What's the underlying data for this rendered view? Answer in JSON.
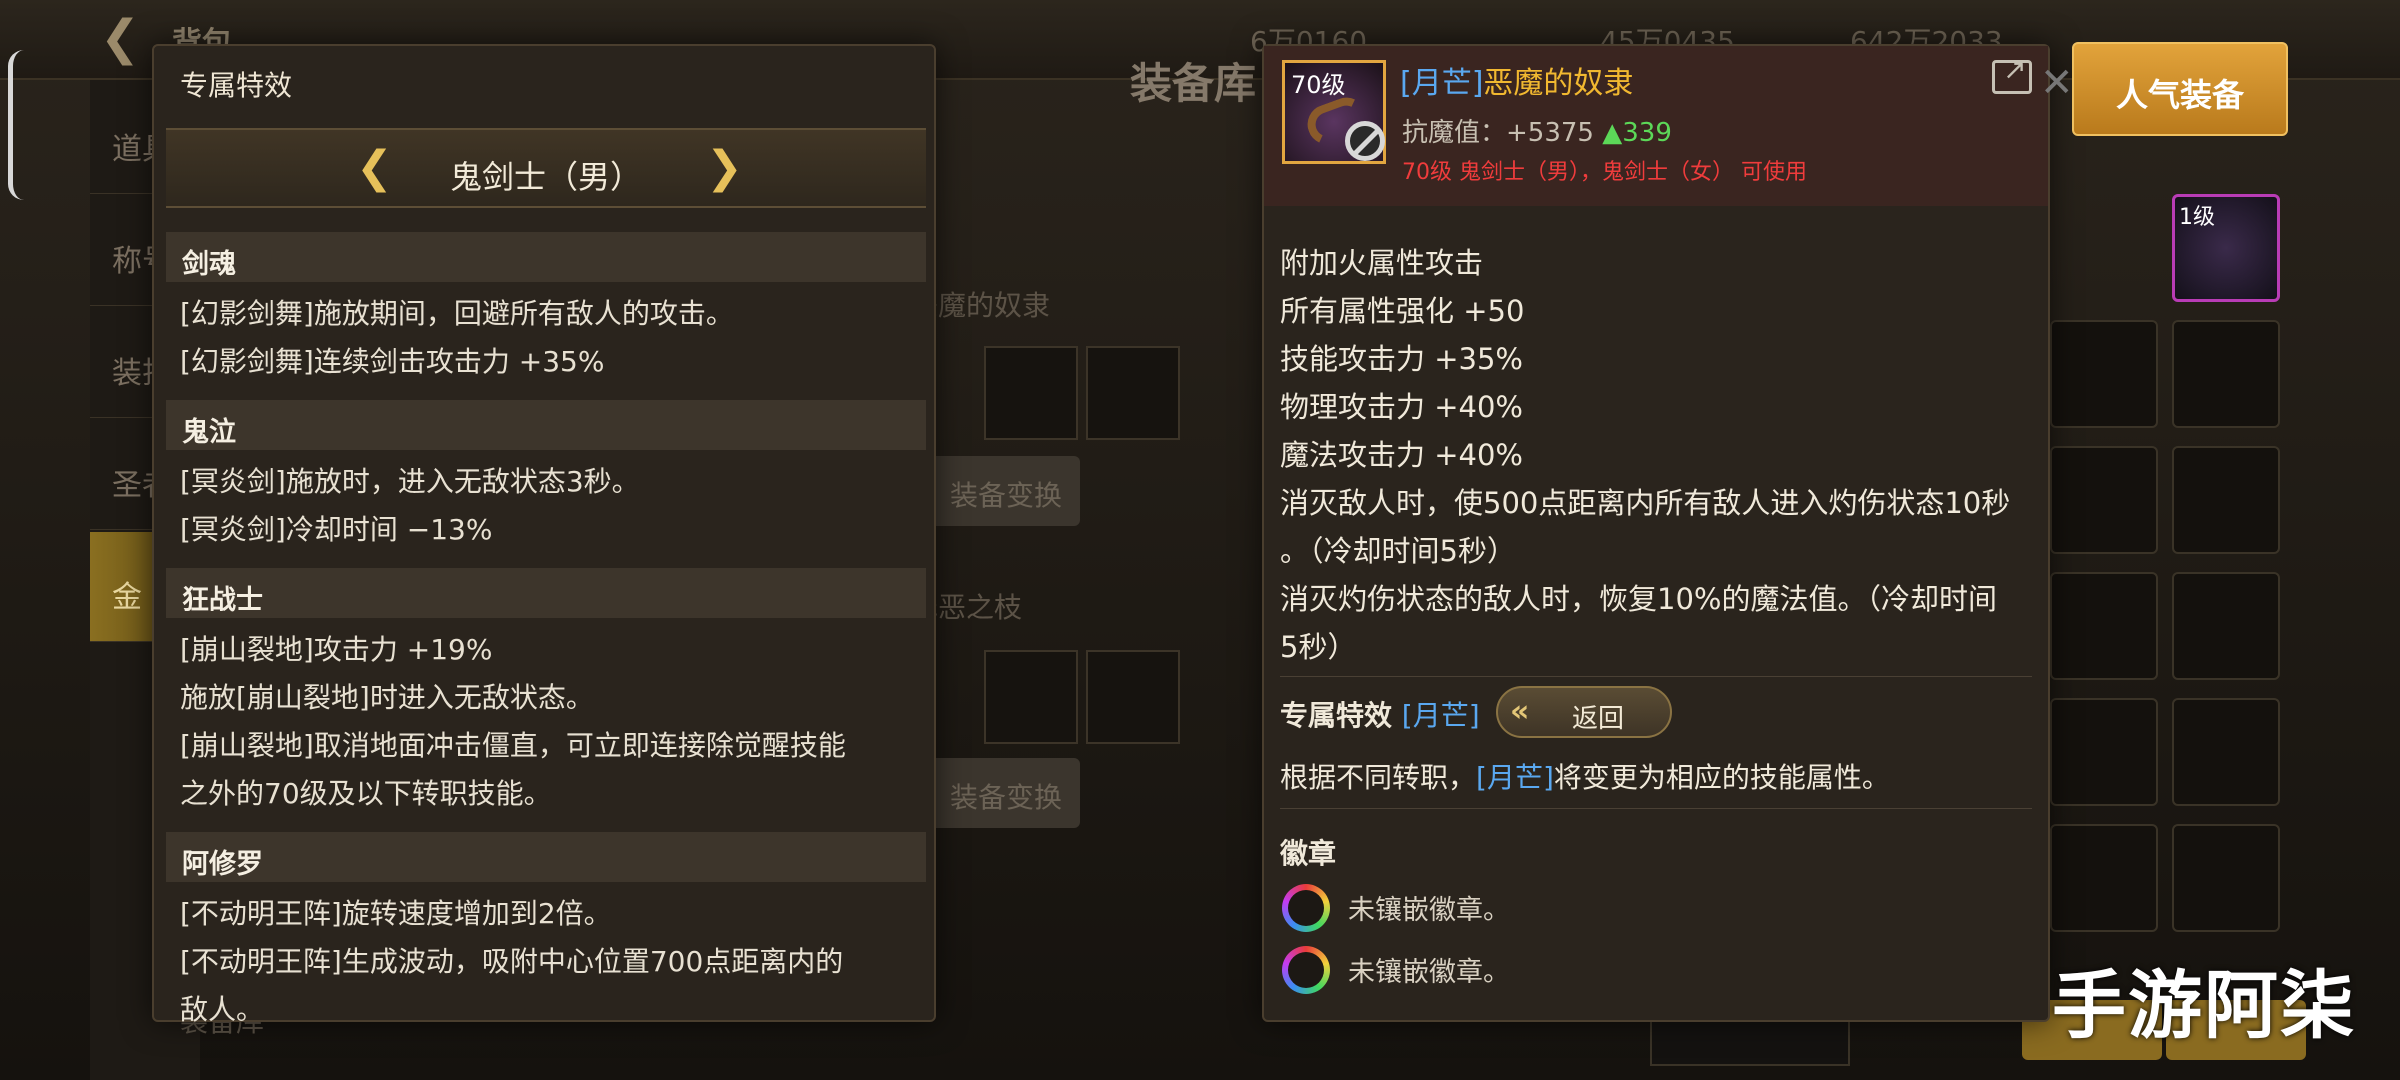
{
  "background": {
    "title": "背包",
    "center_title": "装备库",
    "currencies": [
      "6万0160",
      "45万0435",
      "642万2033"
    ],
    "side_tabs": [
      "道具",
      "称号",
      "装扮",
      "圣者",
      "金"
    ],
    "bg_texts": [
      "恶魔的奴隶",
      "装备变换",
      "罪恶之枝",
      "装备变换",
      "装备库"
    ],
    "slot_level": "70级",
    "right_slot_levels": [
      "1级"
    ]
  },
  "left_panel": {
    "title": "专属特效",
    "class_name": "鬼剑士（男）",
    "sections": [
      {
        "name": "剑魂",
        "lines": [
          "[幻影剑舞]施放期间，回避所有敌人的攻击。",
          "[幻影剑舞]连续剑击攻击力 +35%"
        ]
      },
      {
        "name": "鬼泣",
        "lines": [
          "[冥炎剑]施放时，进入无敌状态3秒。",
          "[冥炎剑]冷却时间 −13%"
        ]
      },
      {
        "name": "狂战士",
        "lines": [
          "[崩山裂地]攻击力 +19%",
          "施放[崩山裂地]时进入无敌状态。",
          "[崩山裂地]取消地面冲击僵直，可立即连接除觉醒技能",
          "之外的70级及以下转职技能。"
        ]
      },
      {
        "name": "阿修罗",
        "lines": [
          "[不动明王阵]旋转速度增加到2倍。",
          "[不动明王阵]生成波动，吸附中心位置700点距离内的",
          "敌人。"
        ]
      }
    ]
  },
  "item": {
    "level": "70级",
    "name_tag": "[月芒]",
    "name": "恶魔的奴隶",
    "stat_label": "抗魔值：+5375",
    "stat_increase": "▲339",
    "requirement": "70级 鬼剑士（男），鬼剑士（女） 可使用",
    "attributes": [
      "附加火属性攻击",
      "所有属性强化 +50",
      "技能攻击力 +35%",
      "物理攻击力 +40%",
      "魔法攻击力 +40%",
      "消灭敌人时，使500点距离内所有敌人进入灼伤状态10秒",
      "。（冷却时间5秒）",
      "消灭灼伤状态的敌人时，恢复10%的魔法值。（冷却时间",
      "5秒）"
    ],
    "exclusive_label": "专属特效",
    "exclusive_tag": "[月芒]",
    "back_label": "返回",
    "desc_prefix": "根据不同转职，",
    "desc_tag": "[月芒]",
    "desc_suffix": "将变更为相应的技能属性。",
    "badge_title": "徽章",
    "badges": [
      "未镶嵌徽章。",
      "未镶嵌徽章。"
    ]
  },
  "popular_button": "人气装备",
  "watermark": "手游阿柒"
}
